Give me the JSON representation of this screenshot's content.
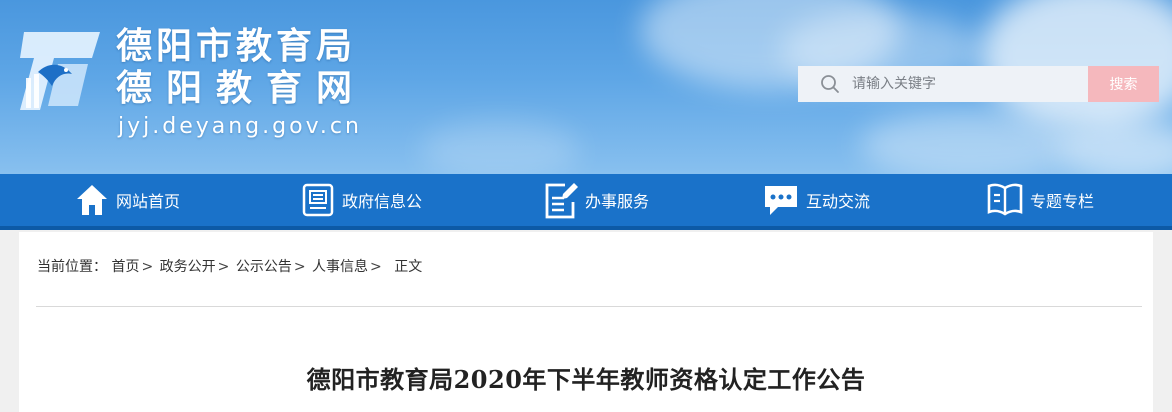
{
  "header": {
    "title_line1": "德阳市教育局",
    "title_line2": "德阳教育网",
    "domain": "jyj.deyang.gov.cn",
    "logo_icon": "bird-logo-icon"
  },
  "search": {
    "placeholder": "请输入关键字",
    "button_label": "搜索",
    "icon": "search-icon"
  },
  "nav": {
    "items": [
      {
        "label": "网站首页",
        "icon": "home-icon"
      },
      {
        "label": "政府信息公",
        "icon": "document-list-icon"
      },
      {
        "label": "办事服务",
        "icon": "edit-form-icon"
      },
      {
        "label": "互动交流",
        "icon": "chat-bubble-icon"
      },
      {
        "label": "专题专栏",
        "icon": "book-icon"
      }
    ]
  },
  "breadcrumb": {
    "prefix": "当前位置：",
    "items": [
      "首页",
      "政务公开",
      "公示公告",
      "人事信息",
      "正文"
    ],
    "separator": ">"
  },
  "article": {
    "title": "德阳市教育局2020年下半年教师资格认定工作公告"
  },
  "colors": {
    "nav_bg": "#1a72c9",
    "search_button_bg": "#f5b8bd",
    "sky_top": "#4a97de"
  }
}
